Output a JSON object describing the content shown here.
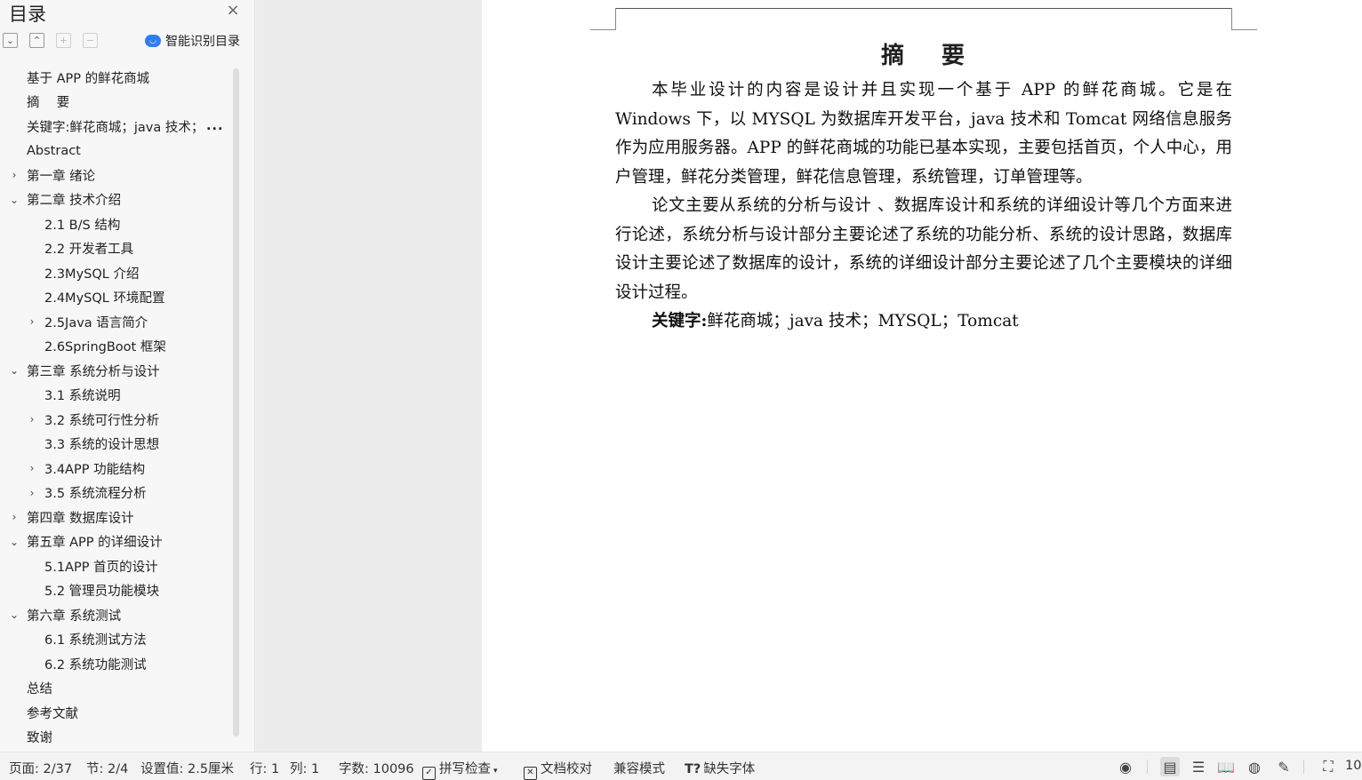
{
  "sidebar": {
    "title": "目录",
    "close_icon": "×",
    "smart_toc_label": "智能识别目录",
    "items": [
      {
        "label": "基于 APP 的鲜花商城",
        "level": 1,
        "chevron": ""
      },
      {
        "label": "摘　 要",
        "level": 1,
        "chevron": ""
      },
      {
        "label": "关键字:鲜花商城；java 技术；",
        "level": 1,
        "chevron": "",
        "more": "..."
      },
      {
        "label": "Abstract",
        "level": 1,
        "chevron": ""
      },
      {
        "label": "第一章  绪论",
        "level": 1,
        "chevron": "›"
      },
      {
        "label": "第二章  技术介绍",
        "level": 1,
        "chevron": "⌄"
      },
      {
        "label": "2.1 B/S 结构",
        "level": 2,
        "chevron": ""
      },
      {
        "label": "2.2 开发者工具",
        "level": 2,
        "chevron": ""
      },
      {
        "label": "2.3MySQL 介绍",
        "level": 2,
        "chevron": ""
      },
      {
        "label": "2.4MySQL 环境配置",
        "level": 2,
        "chevron": ""
      },
      {
        "label": "2.5Java 语言简介",
        "level": 2,
        "chevron": "›"
      },
      {
        "label": "2.6SpringBoot 框架",
        "level": 2,
        "chevron": ""
      },
      {
        "label": "第三章  系统分析与设计",
        "level": 1,
        "chevron": "⌄"
      },
      {
        "label": "3.1 系统说明",
        "level": 2,
        "chevron": ""
      },
      {
        "label": "3.2 系统可行性分析",
        "level": 2,
        "chevron": "›"
      },
      {
        "label": "3.3 系统的设计思想",
        "level": 2,
        "chevron": ""
      },
      {
        "label": "3.4APP 功能结构",
        "level": 2,
        "chevron": "›"
      },
      {
        "label": "3.5 系统流程分析",
        "level": 2,
        "chevron": "›"
      },
      {
        "label": "第四章  数据库设计",
        "level": 1,
        "chevron": "›"
      },
      {
        "label": "第五章  APP 的详细设计",
        "level": 1,
        "chevron": "⌄"
      },
      {
        "label": "5.1APP 首页的设计",
        "level": 2,
        "chevron": ""
      },
      {
        "label": "5.2 管理员功能模块",
        "level": 2,
        "chevron": ""
      },
      {
        "label": "第六章  系统测试",
        "level": 1,
        "chevron": "⌄"
      },
      {
        "label": "6.1 系统测试方法",
        "level": 2,
        "chevron": ""
      },
      {
        "label": "6.2  系统功能测试",
        "level": 2,
        "chevron": ""
      },
      {
        "label": "总结",
        "level": 1,
        "chevron": ""
      },
      {
        "label": "参考文献",
        "level": 1,
        "chevron": ""
      },
      {
        "label": "致谢",
        "level": 1,
        "chevron": ""
      }
    ]
  },
  "document": {
    "title_a": "摘",
    "title_b": "要",
    "paragraph1": "本毕业设计的内容是设计并且实现一个基于 APP 的鲜花商城。它是在 Windows 下，以 MYSQL 为数据库开发平台，java 技术和 Tomcat 网络信息服务作为应用服务器。APP 的鲜花商城的功能已基本实现，主要包括首页，个人中心，用户管理，鲜花分类管理，鲜花信息管理，系统管理，订单管理等。",
    "paragraph2": "论文主要从系统的分析与设计 、数据库设计和系统的详细设计等几个方面来进行论述，系统分析与设计部分主要论述了系统的功能分析、系统的设计思路，数据库设计主要论述了数据库的设计，系统的详细设计部分主要论述了几个主要模块的详细设计过程。",
    "keywords_label": "关键字:",
    "keywords": "鲜花商城；java 技术；MYSQL；Tomcat"
  },
  "statusbar": {
    "page": "页面: 2/37",
    "section": "节: 2/4",
    "setting": "设置值: 2.5厘米",
    "row": "行: 1",
    "col": "列: 1",
    "word_count": "字数: 10096",
    "spell_check": "拼写检查",
    "doc_proofread": "文档校对",
    "compat_mode": "兼容模式",
    "missing_font": "缺失字体",
    "zoom": "10"
  }
}
